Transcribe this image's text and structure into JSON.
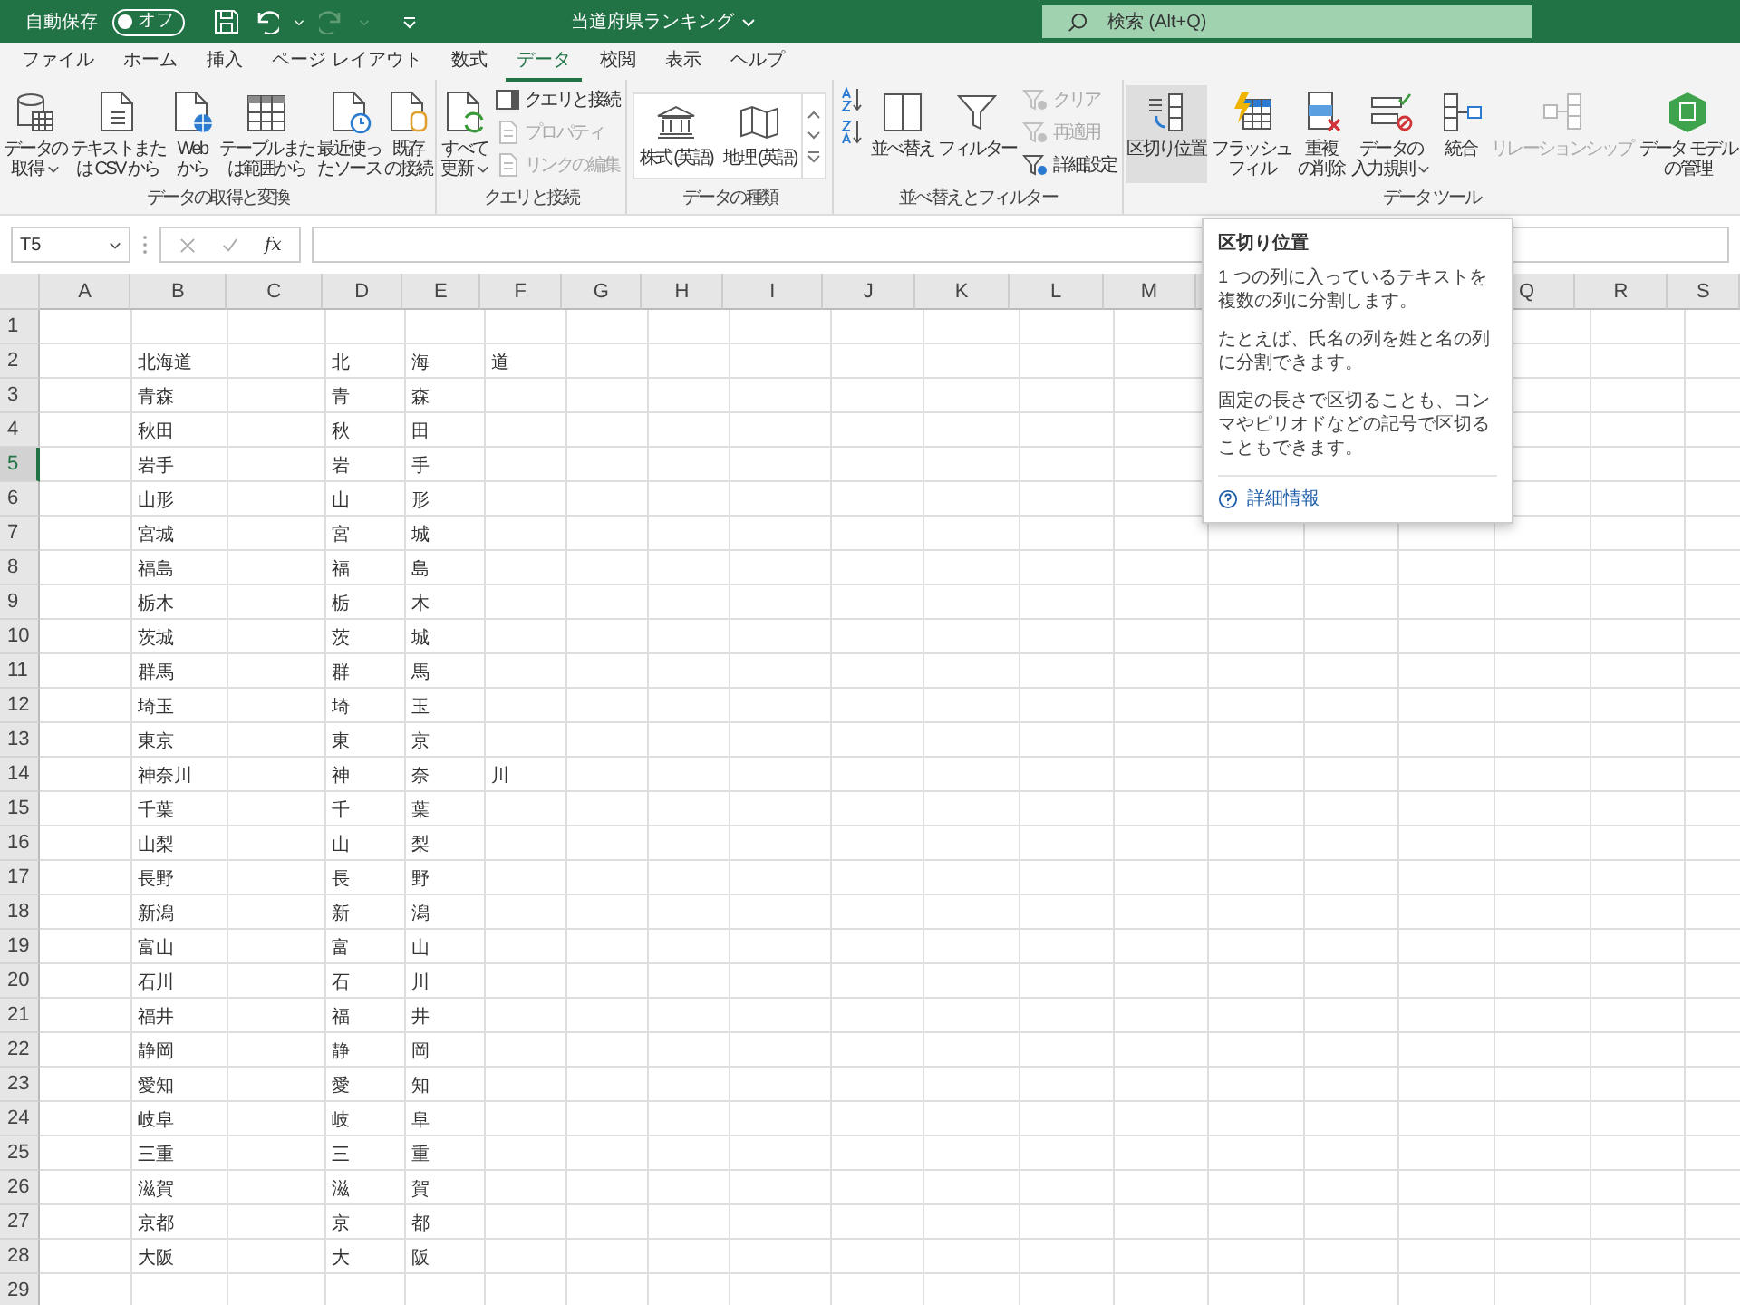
{
  "title_bar": {
    "autosave_label": "自動保存",
    "autosave_toggle": {
      "on": false,
      "label": "オフ"
    },
    "title": "当道府県ランキング",
    "search": {
      "placeholder": "検索 (Alt+Q)"
    }
  },
  "tabs": [
    {
      "label": "ファイル",
      "selected": false
    },
    {
      "label": "ホーム",
      "selected": false
    },
    {
      "label": "挿入",
      "selected": false
    },
    {
      "label": "ページ レイアウト",
      "selected": false
    },
    {
      "label": "数式",
      "selected": false
    },
    {
      "label": "データ",
      "selected": true
    },
    {
      "label": "校閲",
      "selected": false
    },
    {
      "label": "表示",
      "selected": false
    },
    {
      "label": "ヘルプ",
      "selected": false
    }
  ],
  "ribbon": {
    "groups": [
      {
        "label": "データの取得と変換",
        "items": [
          {
            "kind": "large",
            "lines": [
              "データの",
              "取得"
            ],
            "dropdown": true,
            "disabled": false
          },
          {
            "kind": "large",
            "lines": [
              "テキストまた",
              "は CSV から"
            ],
            "dropdown": false,
            "disabled": false
          },
          {
            "kind": "large",
            "lines": [
              "Web",
              "から"
            ],
            "dropdown": false,
            "disabled": false
          },
          {
            "kind": "large",
            "lines": [
              "テーブルまた",
              "は範囲から"
            ],
            "dropdown": false,
            "disabled": false
          },
          {
            "kind": "large",
            "lines": [
              "最近使っ",
              "たソース"
            ],
            "dropdown": false,
            "disabled": false
          },
          {
            "kind": "large",
            "lines": [
              "既存",
              "の接続"
            ],
            "dropdown": false,
            "disabled": false
          }
        ]
      },
      {
        "label": "クエリと接続",
        "items": [
          {
            "kind": "large",
            "lines": [
              "すべて",
              "更新"
            ],
            "dropdown": true,
            "disabled": false
          },
          {
            "kind": "stack",
            "items": [
              {
                "label": "クエリと接続",
                "disabled": false
              },
              {
                "label": "プロパティ",
                "disabled": true
              },
              {
                "label": "リンクの編集",
                "disabled": true
              }
            ]
          }
        ]
      },
      {
        "label": "データの種類",
        "items": [
          {
            "kind": "gallery",
            "items": [
              {
                "label": "株式 (英語)"
              },
              {
                "label": "地理 (英語)"
              }
            ]
          }
        ]
      },
      {
        "label": "並べ替えとフィルター",
        "items": [
          {
            "kind": "stack",
            "items": [
              {
                "disabled": false
              },
              {
                "disabled": false
              }
            ]
          },
          {
            "kind": "large",
            "lines": [
              "並べ替え"
            ],
            "dropdown": false,
            "disabled": false
          },
          {
            "kind": "large",
            "lines": [
              "フィルター"
            ],
            "dropdown": false,
            "disabled": false
          },
          {
            "kind": "stack",
            "items": [
              {
                "label": "クリア",
                "disabled": true
              },
              {
                "label": "再適用",
                "disabled": true
              },
              {
                "label": "詳細設定",
                "disabled": false
              }
            ]
          }
        ]
      },
      {
        "label": "データ ツール",
        "items": [
          {
            "kind": "large",
            "lines": [
              "区切り位置"
            ],
            "dropdown": false,
            "disabled": false,
            "highlighted": true
          },
          {
            "kind": "large",
            "lines": [
              "フラッシュ",
              "フィル"
            ],
            "dropdown": false,
            "disabled": false
          },
          {
            "kind": "large",
            "lines": [
              "重複",
              "の削除"
            ],
            "dropdown": false,
            "disabled": false
          },
          {
            "kind": "large",
            "lines": [
              "データの",
              "入力規則"
            ],
            "dropdown": true,
            "disabled": false
          },
          {
            "kind": "large",
            "lines": [
              "統合"
            ],
            "dropdown": false,
            "disabled": false
          },
          {
            "kind": "large",
            "lines": [
              "リレーションシップ"
            ],
            "dropdown": false,
            "disabled": true
          },
          {
            "kind": "large",
            "lines": [
              "データ モデル",
              "の管理"
            ],
            "dropdown": false,
            "disabled": false
          }
        ]
      }
    ]
  },
  "formula_bar": {
    "name_box": "T5",
    "fx": "fx"
  },
  "sheet": {
    "columns": [
      {
        "label": "A"
      },
      {
        "label": "B"
      },
      {
        "label": "C"
      },
      {
        "label": "D"
      },
      {
        "label": "E"
      },
      {
        "label": "F"
      },
      {
        "label": "G"
      },
      {
        "label": "H"
      },
      {
        "label": "I"
      },
      {
        "label": "J"
      },
      {
        "label": "K"
      },
      {
        "label": "L"
      },
      {
        "label": "M"
      },
      {},
      {},
      {},
      {
        "label": "Q"
      },
      {
        "label": "R"
      },
      {
        "label": "S"
      }
    ],
    "rows": [
      {
        "number": "1",
        "selected": false,
        "cells": {}
      },
      {
        "number": "2",
        "selected": false,
        "cells": {
          "B": "北海道",
          "D": "北",
          "E": "海",
          "F": "道"
        }
      },
      {
        "number": "3",
        "selected": false,
        "cells": {
          "B": "青森",
          "D": "青",
          "E": "森"
        }
      },
      {
        "number": "4",
        "selected": false,
        "cells": {
          "B": "秋田",
          "D": "秋",
          "E": "田"
        }
      },
      {
        "number": "5",
        "selected": true,
        "cells": {
          "B": "岩手",
          "D": "岩",
          "E": "手"
        }
      },
      {
        "number": "6",
        "selected": false,
        "cells": {
          "B": "山形",
          "D": "山",
          "E": "形"
        }
      },
      {
        "number": "7",
        "selected": false,
        "cells": {
          "B": "宮城",
          "D": "宮",
          "E": "城"
        }
      },
      {
        "number": "8",
        "selected": false,
        "cells": {
          "B": "福島",
          "D": "福",
          "E": "島"
        }
      },
      {
        "number": "9",
        "selected": false,
        "cells": {
          "B": "栃木",
          "D": "栃",
          "E": "木"
        }
      },
      {
        "number": "10",
        "selected": false,
        "cells": {
          "B": "茨城",
          "D": "茨",
          "E": "城"
        }
      },
      {
        "number": "11",
        "selected": false,
        "cells": {
          "B": "群馬",
          "D": "群",
          "E": "馬"
        }
      },
      {
        "number": "12",
        "selected": false,
        "cells": {
          "B": "埼玉",
          "D": "埼",
          "E": "玉"
        }
      },
      {
        "number": "13",
        "selected": false,
        "cells": {
          "B": "東京",
          "D": "東",
          "E": "京"
        }
      },
      {
        "number": "14",
        "selected": false,
        "cells": {
          "B": "神奈川",
          "D": "神",
          "E": "奈",
          "F": "川"
        }
      },
      {
        "number": "15",
        "selected": false,
        "cells": {
          "B": "千葉",
          "D": "千",
          "E": "葉"
        }
      },
      {
        "number": "16",
        "selected": false,
        "cells": {
          "B": "山梨",
          "D": "山",
          "E": "梨"
        }
      },
      {
        "number": "17",
        "selected": false,
        "cells": {
          "B": "長野",
          "D": "長",
          "E": "野"
        }
      },
      {
        "number": "18",
        "selected": false,
        "cells": {
          "B": "新潟",
          "D": "新",
          "E": "潟"
        }
      },
      {
        "number": "19",
        "selected": false,
        "cells": {
          "B": "富山",
          "D": "富",
          "E": "山"
        }
      },
      {
        "number": "20",
        "selected": false,
        "cells": {
          "B": "石川",
          "D": "石",
          "E": "川"
        }
      },
      {
        "number": "21",
        "selected": false,
        "cells": {
          "B": "福井",
          "D": "福",
          "E": "井"
        }
      },
      {
        "number": "22",
        "selected": false,
        "cells": {
          "B": "静岡",
          "D": "静",
          "E": "岡"
        }
      },
      {
        "number": "23",
        "selected": false,
        "cells": {
          "B": "愛知",
          "D": "愛",
          "E": "知"
        }
      },
      {
        "number": "24",
        "selected": false,
        "cells": {
          "B": "岐阜",
          "D": "岐",
          "E": "阜"
        }
      },
      {
        "number": "25",
        "selected": false,
        "cells": {
          "B": "三重",
          "D": "三",
          "E": "重"
        }
      },
      {
        "number": "26",
        "selected": false,
        "cells": {
          "B": "滋賀",
          "D": "滋",
          "E": "賀"
        }
      },
      {
        "number": "27",
        "selected": false,
        "cells": {
          "B": "京都",
          "D": "京",
          "E": "都"
        }
      },
      {
        "number": "28",
        "selected": false,
        "cells": {
          "B": "大阪",
          "D": "大",
          "E": "阪"
        }
      },
      {
        "number": "29",
        "selected": false,
        "cells": {}
      }
    ]
  },
  "tooltip": {
    "title": "区切り位置",
    "paragraphs": [
      "1 つの列に入っているテキストを複数の列に分割します。",
      "たとえば、氏名の列を姓と名の列に分割できます。",
      "固定の長さで区切ることも、コンマやピリオドなどの記号で区切ることもできます。"
    ],
    "link": "詳細情報"
  }
}
